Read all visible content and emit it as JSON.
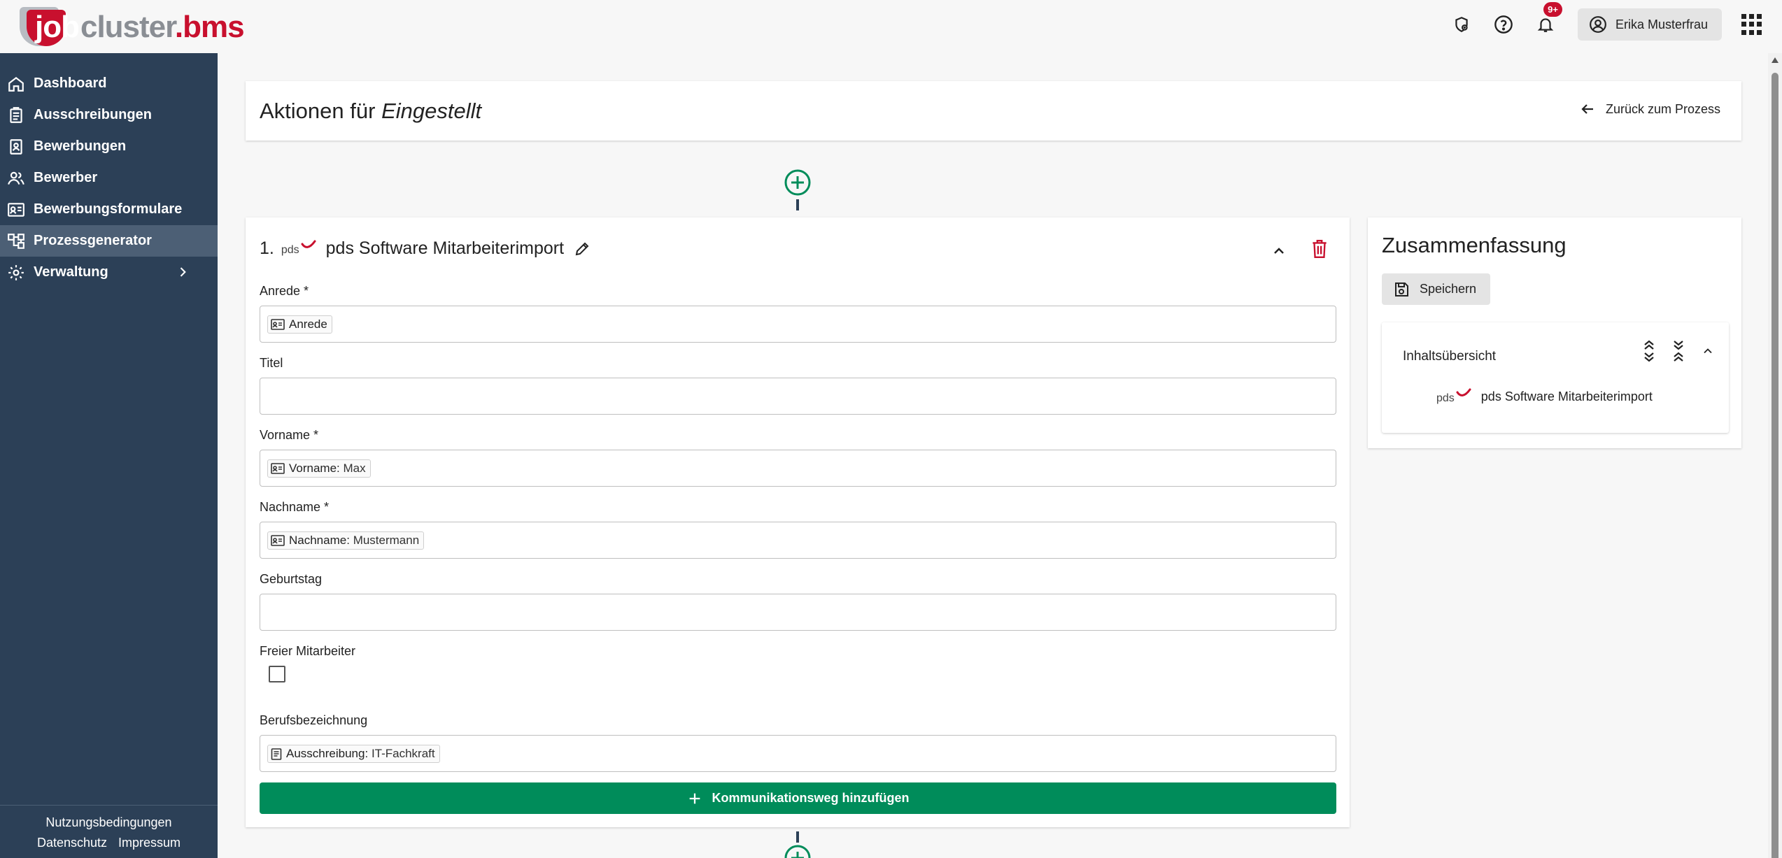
{
  "header": {
    "logo": {
      "part1": "job",
      "part2": "cluster",
      "dot": ".",
      "part3": "bms"
    },
    "notifications_badge": "9+",
    "user_name": "Erika Musterfrau"
  },
  "sidebar": {
    "items": [
      {
        "label": "Dashboard",
        "icon": "home-icon"
      },
      {
        "label": "Ausschreibungen",
        "icon": "clipboard-icon"
      },
      {
        "label": "Bewerbungen",
        "icon": "document-user-icon"
      },
      {
        "label": "Bewerber",
        "icon": "people-icon"
      },
      {
        "label": "Bewerbungsformulare",
        "icon": "id-card-icon"
      },
      {
        "label": "Prozessgenerator",
        "icon": "process-icon"
      },
      {
        "label": "Verwaltung",
        "icon": "gear-icon"
      }
    ],
    "footer": {
      "terms": "Nutzungsbedingungen",
      "privacy": "Datenschutz",
      "imprint": "Impressum"
    }
  },
  "title_card": {
    "prefix": "Aktionen für",
    "status": "Eingestellt",
    "back_label": "Zurück zum Prozess"
  },
  "action": {
    "number": "1.",
    "logo_text": "pds",
    "name": "pds Software Mitarbeiterimport",
    "fields": {
      "anrede": {
        "label": "Anrede *",
        "chip_key": "Anrede",
        "chip_value": ""
      },
      "titel": {
        "label": "Titel"
      },
      "vorname": {
        "label": "Vorname *",
        "chip_key": "Vorname",
        "chip_sep": ":",
        "chip_value": "Max"
      },
      "nachname": {
        "label": "Nachname *",
        "chip_key": "Nachname",
        "chip_sep": ":",
        "chip_value": "Mustermann"
      },
      "geburtstag": {
        "label": "Geburtstag"
      },
      "freier": {
        "label": "Freier Mitarbeiter"
      },
      "beruf": {
        "label": "Berufsbezeichnung",
        "chip_key": "Ausschreibung",
        "chip_sep": ":",
        "chip_value": "IT-Fachkraft"
      }
    },
    "add_button": "Kommunikationsweg hinzufügen"
  },
  "summary": {
    "title": "Zusammenfassung",
    "save_label": "Speichern",
    "overview_title": "Inhaltsübersicht",
    "overview_logo": "pds",
    "overview_item": "pds Software Mitarbeiterimport"
  },
  "colors": {
    "sidebar": "#2c4057",
    "sidebar_active": "#4c5f75",
    "accent_green": "#008c5a",
    "brand_red": "#c8102e"
  }
}
